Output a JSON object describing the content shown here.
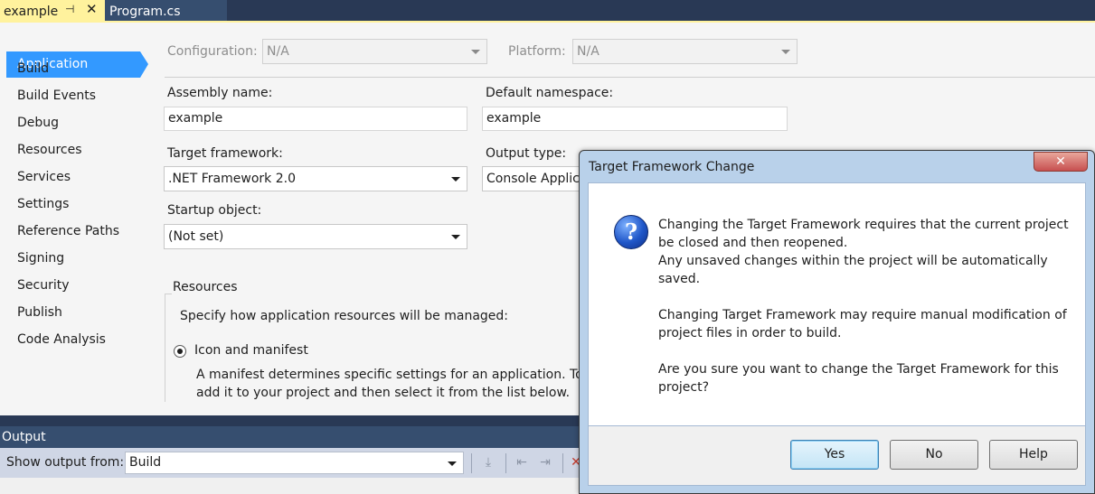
{
  "tabs": [
    {
      "label": "example",
      "active": true
    },
    {
      "label": "Program.cs",
      "active": false
    }
  ],
  "nav": {
    "selected": "Application",
    "items": [
      "Build",
      "Build Events",
      "Debug",
      "Resources",
      "Services",
      "Settings",
      "Reference Paths",
      "Signing",
      "Security",
      "Publish",
      "Code Analysis"
    ]
  },
  "page": {
    "configuration_label": "Configuration:",
    "configuration_value": "N/A",
    "platform_label": "Platform:",
    "platform_value": "N/A",
    "assembly_name_label": "Assembly name:",
    "assembly_name_value": "example",
    "default_namespace_label": "Default namespace:",
    "default_namespace_value": "example",
    "target_framework_label": "Target framework:",
    "target_framework_value": ".NET Framework 2.0",
    "output_type_label": "Output type:",
    "output_type_value": "Console Applica",
    "startup_object_label": "Startup object:",
    "startup_object_value": "(Not set)",
    "resources_group_label": "Resources",
    "resources_description": "Specify how application resources will be managed:",
    "icon_manifest_label": "Icon and manifest",
    "manifest_desc_line1": "A manifest determines specific settings for an application. To en",
    "manifest_desc_line2": "add it to your project and then select it from the list below."
  },
  "output": {
    "title": "Output",
    "show_from_label": "Show output from:",
    "show_from_value": "Build"
  },
  "dialog": {
    "title": "Target Framework Change",
    "close_glyph": "✕",
    "icon": "question-icon",
    "lines": [
      "Changing the Target Framework requires that the current project",
      "be closed and then reopened.",
      "Any unsaved changes within the project will be automatically",
      "saved.",
      "Changing Target Framework may require manual modification of",
      "project files in order to build.",
      "Are you sure you want to change the Target Framework for this",
      "project?"
    ],
    "yes_label": "Yes",
    "no_label": "No",
    "help_label": "Help"
  },
  "colors": {
    "tab_active": "#fff29d",
    "chrome_dark": "#293955",
    "nav_selected": "#3399ff"
  }
}
